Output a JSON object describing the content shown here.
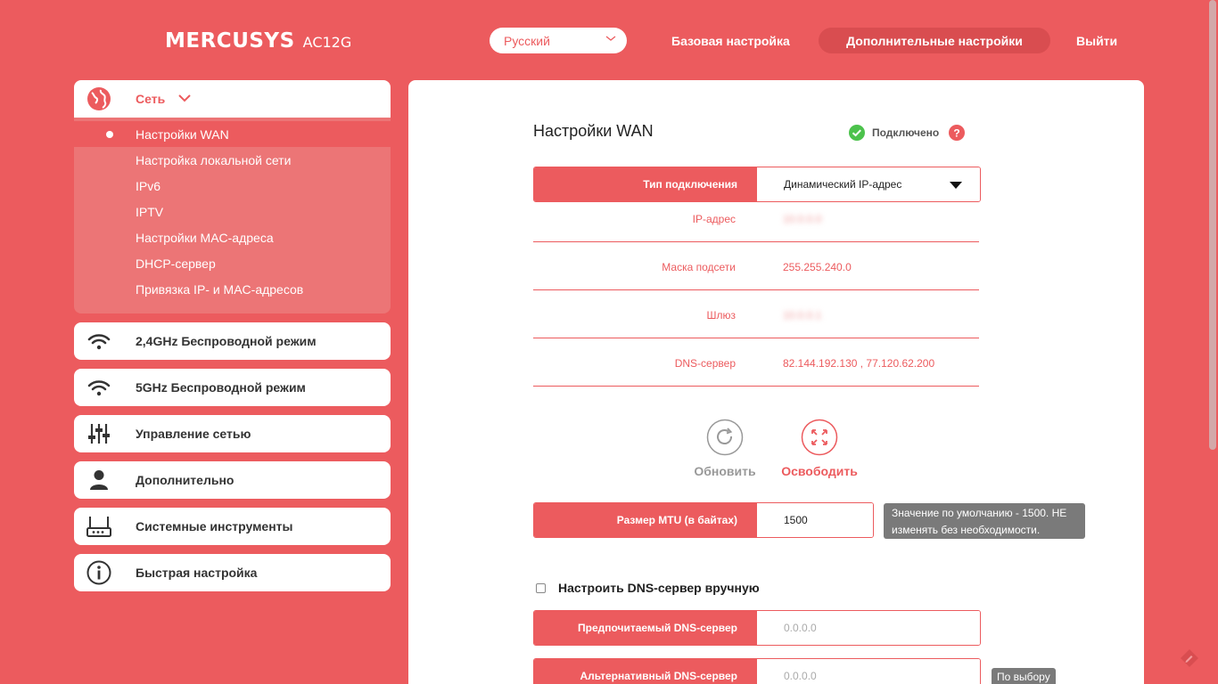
{
  "header": {
    "brand": "MERCUSYS",
    "model": "AC12G",
    "language": "Русский",
    "nav_basic": "Базовая настройка",
    "nav_advanced": "Дополнительные настройки",
    "nav_logout": "Выйти"
  },
  "sidebar": {
    "network": {
      "label": "Сеть",
      "icon": "globe-icon",
      "items": [
        {
          "label": "Настройки WAN",
          "active": true
        },
        {
          "label": "Настройка локальной сети"
        },
        {
          "label": "IPv6"
        },
        {
          "label": "IPTV"
        },
        {
          "label": "Настройки MAC-адреса"
        },
        {
          "label": "DHCP-сервер"
        },
        {
          "label": "Привязка IP- и MAC-адресов"
        }
      ]
    },
    "sections": [
      {
        "label": "2,4GHz Беспроводной режим",
        "icon": "wifi-icon"
      },
      {
        "label": "5GHz Беспроводной режим",
        "icon": "wifi-icon"
      },
      {
        "label": "Управление сетью",
        "icon": "sliders-icon"
      },
      {
        "label": "Дополнительно",
        "icon": "user-icon"
      },
      {
        "label": "Системные инструменты",
        "icon": "router-icon"
      },
      {
        "label": "Быстрая настройка",
        "icon": "info-icon"
      }
    ]
  },
  "main": {
    "title": "Настройки WAN",
    "status": "Подключено",
    "connection_type": {
      "label": "Тип подключения",
      "value": "Динамический IP-адрес"
    },
    "info": [
      {
        "label": "IP-адрес",
        "value": "10.0.0.0",
        "blurred": true
      },
      {
        "label": "Маска подсети",
        "value": "255.255.240.0",
        "blurred": false
      },
      {
        "label": "Шлюз",
        "value": "10.0.0.1",
        "blurred": true
      },
      {
        "label": "DNS-сервер",
        "value": "82.144.192.130 , 77.120.62.200",
        "blurred": false
      }
    ],
    "refresh_label": "Обновить",
    "release_label": "Освободить",
    "mtu": {
      "label": "Размер MTU (в байтах)",
      "value": "1500",
      "hint": "Значение по умолчанию - 1500. НЕ изменять без необходимости."
    },
    "manual_dns_label": "Настроить DNS-сервер вручную",
    "preferred_dns": {
      "label": "Предпочитаемый DNS-сервер",
      "placeholder": "0.0.0.0"
    },
    "alternate_dns": {
      "label": "Альтернативный DNS-сервер",
      "placeholder": "0.0.0.0",
      "hint": "По выбору"
    }
  },
  "colors": {
    "accent": "#ec5b5e",
    "ok": "#4cc24c",
    "tooltip": "#7a7a7a"
  }
}
